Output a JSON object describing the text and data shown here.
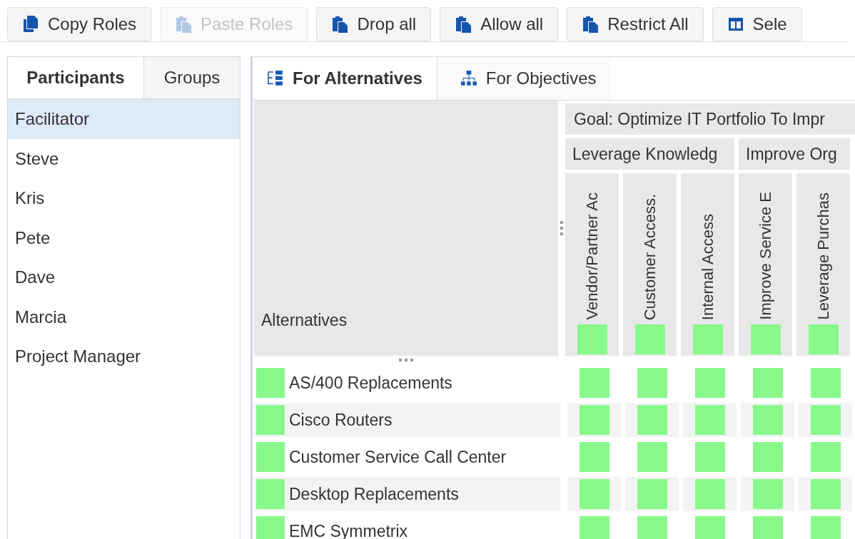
{
  "toolbar": [
    {
      "label": "Copy Roles",
      "kind": "copy",
      "disabled": false
    },
    {
      "label": "Paste Roles",
      "kind": "paste",
      "disabled": true
    },
    {
      "label": "Drop all",
      "kind": "paste",
      "disabled": false
    },
    {
      "label": "Allow all",
      "kind": "paste",
      "disabled": false
    },
    {
      "label": "Restrict All",
      "kind": "paste",
      "disabled": false
    },
    {
      "label": "Sele",
      "kind": "columns",
      "disabled": false
    }
  ],
  "left_tabs": [
    {
      "label": "Participants",
      "selected": true
    },
    {
      "label": "Groups",
      "selected": false
    }
  ],
  "participants": [
    {
      "name": "Facilitator",
      "selected": true
    },
    {
      "name": "Steve",
      "selected": false
    },
    {
      "name": "Kris",
      "selected": false
    },
    {
      "name": "Pete",
      "selected": false
    },
    {
      "name": "Dave",
      "selected": false
    },
    {
      "name": "Marcia",
      "selected": false
    },
    {
      "name": "Project Manager",
      "selected": false
    }
  ],
  "right_tabs": [
    {
      "label": "For Alternatives",
      "kind": "list",
      "selected": true
    },
    {
      "label": "For Objectives",
      "kind": "hierarchy",
      "selected": false
    }
  ],
  "grid": {
    "corner_label": "Alternatives",
    "goal": "Goal: Optimize IT Portfolio To Impr",
    "groups": [
      {
        "label": "Leverage Knowledg",
        "columns": [
          {
            "label": "Vendor/Partner Ac",
            "allowed": true
          },
          {
            "label": "Customer Access.",
            "allowed": true
          },
          {
            "label": "Internal Access",
            "allowed": true
          }
        ]
      },
      {
        "label": "Improve Org",
        "columns": [
          {
            "label": "Improve Service E",
            "allowed": true
          },
          {
            "label": "Leverage Purchas",
            "allowed": true
          }
        ]
      }
    ],
    "rows": [
      {
        "name": "AS/400 Replacements",
        "allowed": true,
        "cells": [
          {
            "allowed": true
          },
          {
            "allowed": true
          },
          {
            "allowed": true
          },
          {
            "allowed": true
          },
          {
            "allowed": true
          }
        ]
      },
      {
        "name": "Cisco Routers",
        "allowed": true,
        "cells": [
          {
            "allowed": true
          },
          {
            "allowed": true
          },
          {
            "allowed": true
          },
          {
            "allowed": true
          },
          {
            "allowed": true
          }
        ]
      },
      {
        "name": "Customer Service Call Center",
        "allowed": true,
        "cells": [
          {
            "allowed": true
          },
          {
            "allowed": true
          },
          {
            "allowed": true
          },
          {
            "allowed": true
          },
          {
            "allowed": true
          }
        ]
      },
      {
        "name": "Desktop Replacements",
        "allowed": true,
        "cells": [
          {
            "allowed": true
          },
          {
            "allowed": true
          },
          {
            "allowed": true
          },
          {
            "allowed": true
          },
          {
            "allowed": true
          }
        ]
      },
      {
        "name": "EMC Symmetrix",
        "allowed": true,
        "cells": [
          {
            "allowed": true
          },
          {
            "allowed": true
          },
          {
            "allowed": true
          },
          {
            "allowed": true
          },
          {
            "allowed": true
          }
        ]
      }
    ]
  }
}
